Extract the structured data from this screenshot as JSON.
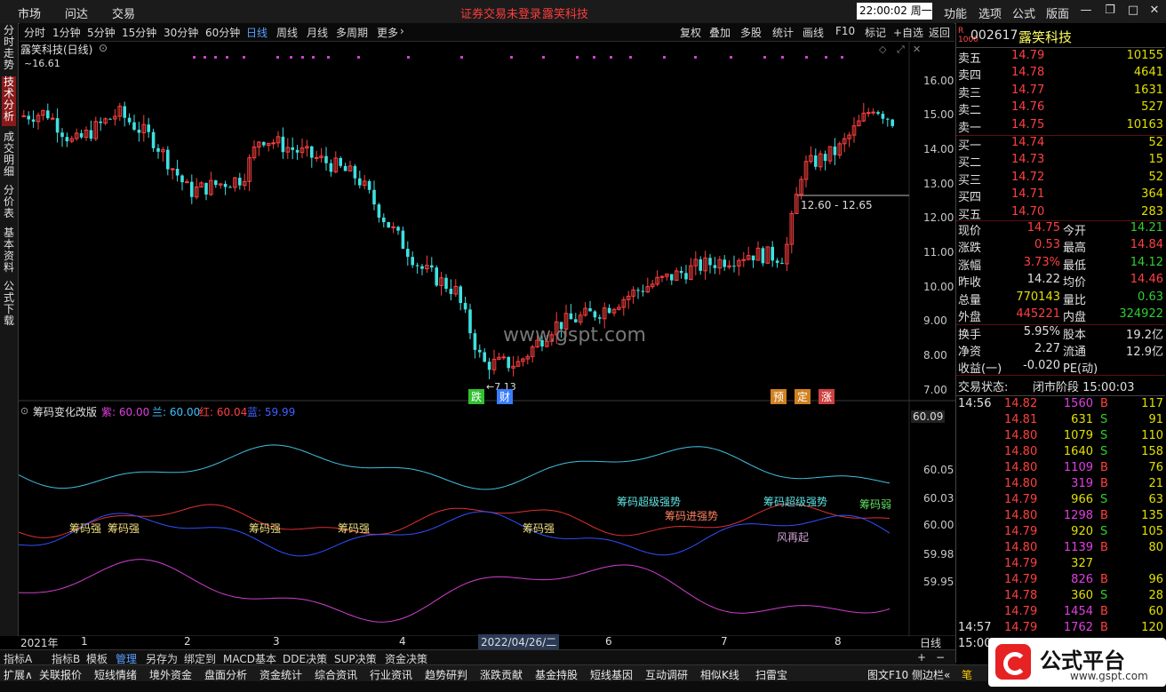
{
  "menubar": {
    "items": [
      "市场",
      "问达",
      "交易"
    ],
    "warn_login": "证券交易未登录",
    "warn_stock": "露笑科技",
    "clock": "22:00:02 周一",
    "right_items": [
      "功能",
      "选项",
      "公式",
      "版面"
    ]
  },
  "toolbar": {
    "periods": [
      "分时",
      "1分钟",
      "5分钟",
      "15分钟",
      "30分钟",
      "60分钟",
      "日线",
      "周线",
      "月线",
      "多周期",
      "更多"
    ],
    "active_period": "日线",
    "right": [
      "复权",
      "叠加",
      "多股",
      "统计",
      "画线",
      "F10",
      "标记",
      "+自选",
      "返回"
    ]
  },
  "left_tabs": [
    "分时走势",
    "技术分析",
    "成交明细",
    "分价表",
    "基本资料",
    "公式下载"
  ],
  "chart": {
    "title": "露笑科技(日线)",
    "high_label": "16.61",
    "low_label": "7.13",
    "range_label": "12.60 - 12.65",
    "watermark": "www.gspt.com",
    "price_ticks": [
      "16.00",
      "15.00",
      "14.00",
      "13.00",
      "12.00",
      "11.00",
      "10.00",
      "9.00",
      "8.00",
      "7.00"
    ],
    "event_tags": [
      {
        "text": "跌",
        "color": "#30c030"
      },
      {
        "text": "财",
        "color": "#3a7dff"
      },
      {
        "text": "预",
        "color": "#d08020"
      },
      {
        "text": "定",
        "color": "#d08020"
      },
      {
        "text": "涨",
        "color": "#d04040"
      }
    ],
    "indicator_title": "筹码变化改版",
    "indicator_legend": [
      {
        "text": "紫: 60.00",
        "color": "#e040e0"
      },
      {
        "text": "兰: 60.00",
        "color": "#40c0ff"
      },
      {
        "text": "红: 60.04",
        "color": "#ff4040"
      },
      {
        "text": "蓝: 59.99",
        "color": "#4060ff"
      }
    ],
    "indicator_ticks": [
      "60.09",
      "60.05",
      "60.03",
      "60.00",
      "59.98",
      "59.95"
    ],
    "indicator_labels": [
      {
        "text": "筹码强",
        "color": "#f0e080"
      },
      {
        "text": "筹码强",
        "color": "#f0e080"
      },
      {
        "text": "筹码强",
        "color": "#f0e080"
      },
      {
        "text": "筹码强",
        "color": "#f0e080"
      },
      {
        "text": "筹码强",
        "color": "#f0e080"
      },
      {
        "text": "筹码超级强势",
        "color": "#60e0e0"
      },
      {
        "text": "筹码进强势",
        "color": "#ff8060"
      },
      {
        "text": "筹码超级强势",
        "color": "#60e0e0"
      },
      {
        "text": "筹码弱",
        "color": "#60e060"
      },
      {
        "text": "风再起",
        "color": "#d0a0d0"
      }
    ],
    "x_ticks": [
      "2021年",
      "1",
      "2",
      "3",
      "4",
      "5",
      "6",
      "7",
      "8"
    ],
    "crosshair_date": "2022/04/26/二",
    "axis_mode": "日线"
  },
  "bottom_tabs": [
    "指标A",
    "指标B",
    "模板",
    "管理",
    "另存为",
    "绑定到",
    "MACD基本",
    "DDE决策",
    "SUP决策",
    "资金决策"
  ],
  "bottom_active": "管理",
  "info_tabs": [
    "扩展∧",
    "关联报价",
    "短线情绪",
    "境外资金",
    "盘面分析",
    "资金统计",
    "综合资讯",
    "行业资讯",
    "趋势研判",
    "涨跌贡献",
    "基金持股",
    "短线基因",
    "互动调研",
    "相似K线",
    "扫雷宝"
  ],
  "info_right": [
    "图文F10",
    "侧边栏«",
    "笔"
  ],
  "quote": {
    "code": "002617",
    "name": "露笑科技",
    "badge": "R",
    "asks": [
      {
        "label": "卖五",
        "price": "14.79",
        "vol": "10155"
      },
      {
        "label": "卖四",
        "price": "14.78",
        "vol": "4641"
      },
      {
        "label": "卖三",
        "price": "14.77",
        "vol": "1631"
      },
      {
        "label": "卖二",
        "price": "14.76",
        "vol": "527"
      },
      {
        "label": "卖一",
        "price": "14.75",
        "vol": "10163"
      }
    ],
    "bids": [
      {
        "label": "买一",
        "price": "14.74",
        "vol": "52"
      },
      {
        "label": "买二",
        "price": "14.73",
        "vol": "15"
      },
      {
        "label": "买三",
        "price": "14.72",
        "vol": "52"
      },
      {
        "label": "买四",
        "price": "14.71",
        "vol": "364"
      },
      {
        "label": "买五",
        "price": "14.70",
        "vol": "283"
      }
    ],
    "stats": [
      {
        "l1": "现价",
        "v1": "14.75",
        "c1": "#ff4040",
        "l2": "今开",
        "v2": "14.21",
        "c2": "#30d030"
      },
      {
        "l1": "涨跌",
        "v1": "0.53",
        "c1": "#ff4040",
        "l2": "最高",
        "v2": "14.84",
        "c2": "#ff4040"
      },
      {
        "l1": "涨幅",
        "v1": "3.73%",
        "c1": "#ff4040",
        "l2": "最低",
        "v2": "14.12",
        "c2": "#30d030"
      },
      {
        "l1": "昨收",
        "v1": "14.22",
        "c1": "#e0e0e0",
        "l2": "均价",
        "v2": "14.46",
        "c2": "#ff4040"
      },
      {
        "l1": "总量",
        "v1": "770143",
        "c1": "#e0e000",
        "l2": "量比",
        "v2": "0.63",
        "c2": "#30d030"
      },
      {
        "l1": "外盘",
        "v1": "445221",
        "c1": "#ff4040",
        "l2": "内盘",
        "v2": "324922",
        "c2": "#30d030"
      }
    ],
    "fund": [
      {
        "l1": "换手",
        "v1": "5.95%",
        "l2": "股本",
        "v2": "19.2亿"
      },
      {
        "l1": "净资",
        "v1": "2.27",
        "l2": "流通",
        "v2": "12.9亿"
      },
      {
        "l1": "收益(一)",
        "v1": "-0.020",
        "l2": "PE(动)",
        "v2": ""
      }
    ],
    "trade_state_label": "交易状态:",
    "trade_state": "闭市阶段 15:00:03",
    "ticks": [
      {
        "t": "14:56",
        "p": "14.82",
        "v": "1560",
        "s": "B",
        "n": "117"
      },
      {
        "t": "",
        "p": "14.81",
        "v": "631",
        "s": "S",
        "n": "91"
      },
      {
        "t": "",
        "p": "14.80",
        "v": "1079",
        "s": "S",
        "n": "110"
      },
      {
        "t": "",
        "p": "14.80",
        "v": "1640",
        "s": "S",
        "n": "158"
      },
      {
        "t": "",
        "p": "14.80",
        "v": "1109",
        "s": "B",
        "n": "76"
      },
      {
        "t": "",
        "p": "14.80",
        "v": "319",
        "s": "B",
        "n": "21"
      },
      {
        "t": "",
        "p": "14.79",
        "v": "966",
        "s": "S",
        "n": "63"
      },
      {
        "t": "",
        "p": "14.80",
        "v": "1298",
        "s": "B",
        "n": "135"
      },
      {
        "t": "",
        "p": "14.79",
        "v": "920",
        "s": "S",
        "n": "105"
      },
      {
        "t": "",
        "p": "14.80",
        "v": "1139",
        "s": "B",
        "n": "80"
      },
      {
        "t": "",
        "p": "14.79",
        "v": "327",
        "s": "",
        "n": ""
      },
      {
        "t": "",
        "p": "14.79",
        "v": "826",
        "s": "B",
        "n": "96"
      },
      {
        "t": "",
        "p": "14.78",
        "v": "360",
        "s": "S",
        "n": "28"
      },
      {
        "t": "",
        "p": "14.79",
        "v": "1454",
        "s": "B",
        "n": "60"
      },
      {
        "t": "14:57",
        "p": "14.79",
        "v": "1762",
        "s": "B",
        "n": "120"
      },
      {
        "t": "15:00",
        "p": "",
        "v": "",
        "s": "",
        "n": ""
      }
    ]
  },
  "brand": {
    "title": "公式平台",
    "url": "www.gspt.com"
  },
  "colors": {
    "up": "#ff4040",
    "down": "#40e0e0",
    "accent": "#5aa0ff",
    "tab_active": "#8a1a1a"
  }
}
